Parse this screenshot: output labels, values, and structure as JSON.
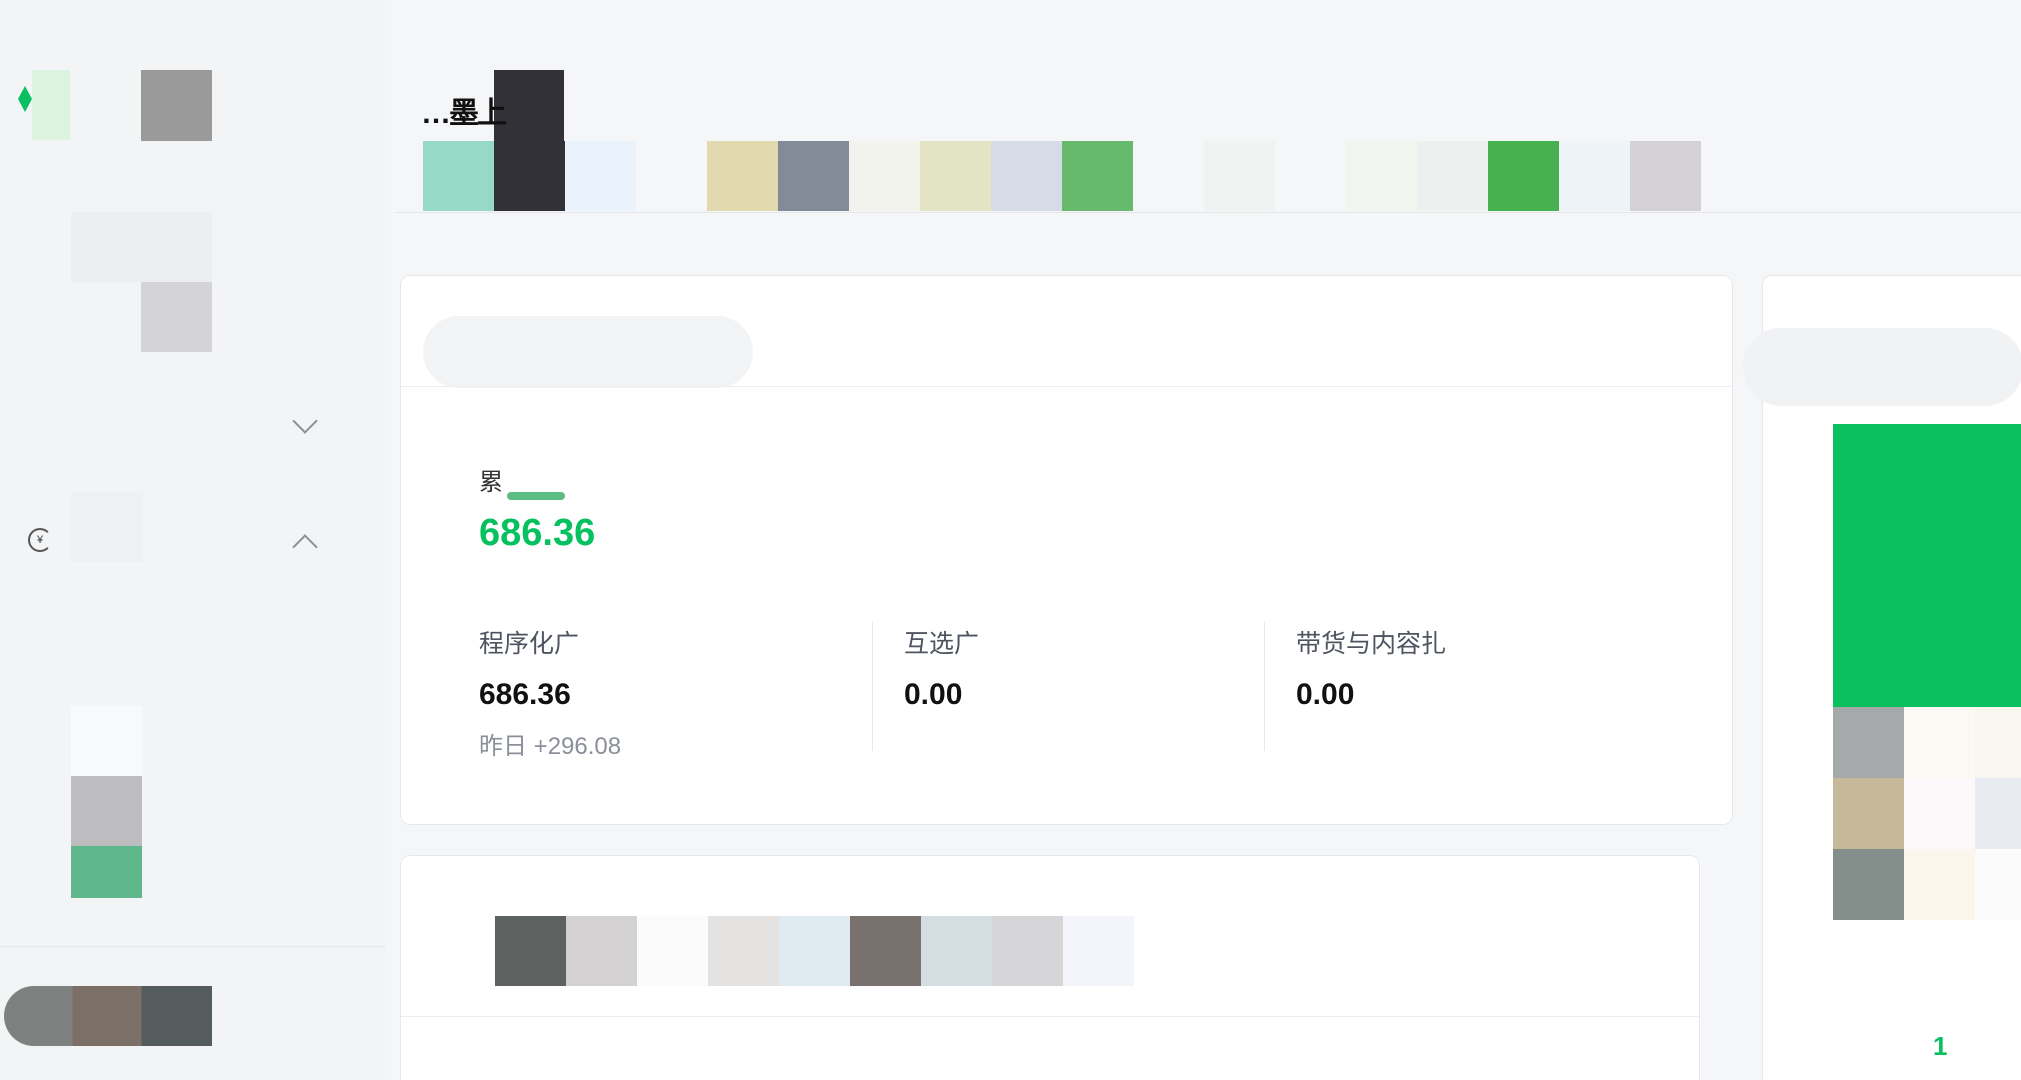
{
  "overview": {
    "total_label": "累",
    "total_value": "686.36",
    "stats": [
      {
        "label": "程序化广",
        "value": "686.36",
        "yesterday_label": "昨日",
        "yesterday_delta": "+296.08"
      },
      {
        "label": "互选广",
        "value": "0.00"
      },
      {
        "label": "带货与内容扎",
        "value": "0.00"
      }
    ]
  },
  "header": {
    "title_fragment": "…墨上"
  },
  "right_panel": {
    "page_indicator": "1"
  },
  "sidebar": {
    "currency_icon_glyph": "¥"
  },
  "colors": {
    "accent": "#07c160",
    "header_swatches": [
      "#96d9c4",
      "#333138",
      "#eaf3fb",
      "#f5f6f8",
      "#e3d9b1",
      "#838a98",
      "#f2f3ed",
      "#e3e4c4",
      "#d5dce7",
      "#67b96c",
      "#f5f6f8",
      "#f1f2f2",
      "#f5f6f8",
      "#f0f5f0",
      "#eef0f0",
      "#47b04f",
      "#eef3f8",
      "#d3d1d4"
    ],
    "bottom_swatches": [
      "#5d6261",
      "#d3d1d2",
      "#fbfbfc",
      "#e4e3e2",
      "#e0eaf1",
      "#78716d",
      "#d4dde1",
      "#d6d5d7",
      "#f3f5fa"
    ],
    "right_mosaic": [
      "#a5a9a9",
      "#fcf8f4",
      "#f8f7ef",
      "#c5b999",
      "#fcf9fb",
      "#e8ecf2",
      "#848f8c",
      "#faf6ec",
      "#fbfbfb"
    ]
  }
}
